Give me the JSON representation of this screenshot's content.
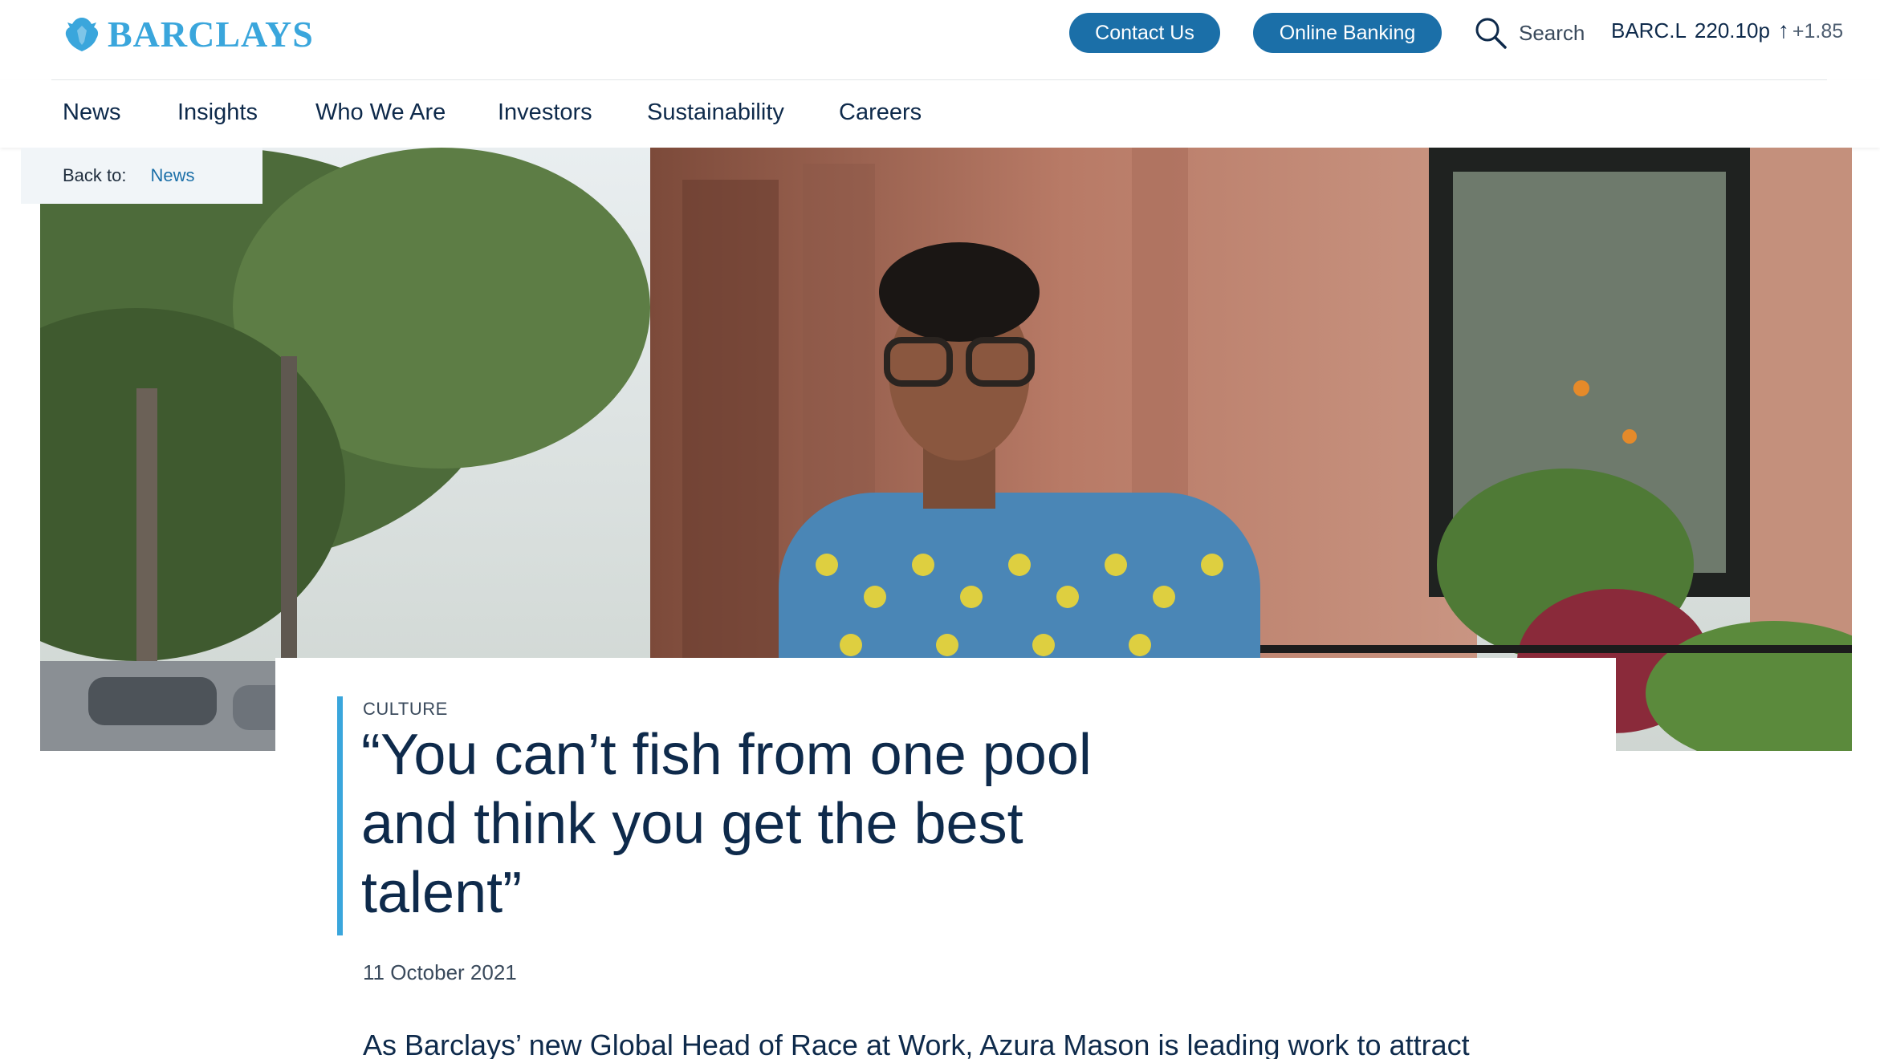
{
  "brand": {
    "name": "BARCLAYS",
    "color": "#3aa6dc"
  },
  "header": {
    "contact_label": "Contact Us",
    "online_banking_label": "Online Banking",
    "search_label": "Search",
    "search_icon": "search-icon",
    "ticker": {
      "symbol": "BARC.L",
      "price": "220.10p",
      "arrow": "↑",
      "change": "+1.85"
    }
  },
  "nav": {
    "items": [
      {
        "label": "News"
      },
      {
        "label": "Insights"
      },
      {
        "label": "Who We Are"
      },
      {
        "label": "Investors"
      },
      {
        "label": "Sustainability"
      },
      {
        "label": "Careers"
      }
    ]
  },
  "breadcrumb": {
    "back_label": "Back to:",
    "link_label": "News"
  },
  "article": {
    "category": "CULTURE",
    "headline_lines": [
      "“You can’t fish from one pool",
      "and think you get the best",
      "talent”"
    ],
    "date": "11 October 2021",
    "intro": "As Barclays’ new Global Head of Race at Work, Azura Mason is leading work to attract"
  },
  "colors": {
    "primary_button": "#1b6fa8",
    "accent_bar": "#3aa6dc",
    "text_dark": "#0e2a4b"
  }
}
